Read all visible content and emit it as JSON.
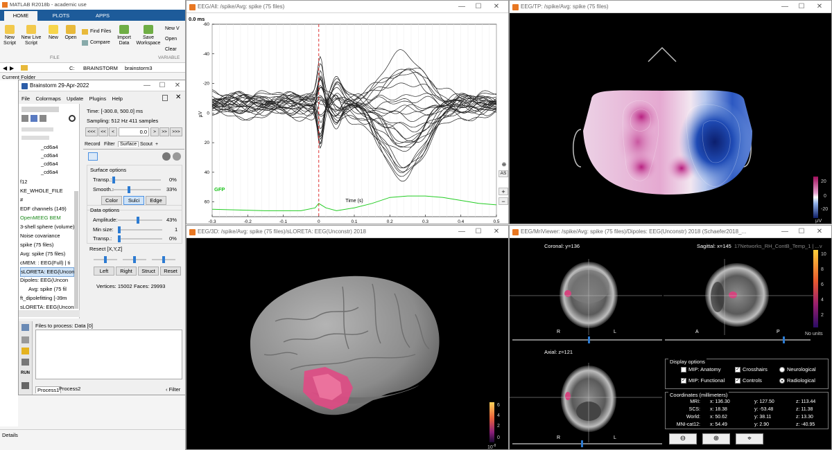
{
  "matlab": {
    "title": "MATLAB R2018b - academic use",
    "tabs": [
      "HOME",
      "PLOTS",
      "APPS"
    ],
    "ribbon": [
      {
        "label": "New Script",
        "icon": "new-script-icon"
      },
      {
        "label": "New Live Script",
        "icon": "new-live-script-icon"
      },
      {
        "label": "New",
        "icon": "new-icon"
      },
      {
        "label": "Open",
        "icon": "open-folder-icon"
      },
      {
        "label": "Find Files",
        "icon": "find-files-icon"
      },
      {
        "label": "Compare",
        "icon": "compare-icon"
      },
      {
        "label": "Import Data",
        "icon": "import-icon"
      },
      {
        "label": "Save Workspace",
        "icon": "save-icon"
      },
      {
        "label": "New V",
        "icon": "new-variable-icon"
      },
      {
        "label": "Open",
        "icon": "open-variable-icon"
      },
      {
        "label": "Clear",
        "icon": "clear-icon"
      }
    ],
    "section_file": "FILE",
    "section_variable": "VARIABLE",
    "path": [
      "C:",
      "BRAINSTORM",
      "brainstorm3"
    ],
    "current_folder": "Current Folder",
    "details": "Details"
  },
  "bst": {
    "title": "Brainstorm 29-Apr-2022",
    "menu": [
      "File",
      "Colormaps",
      "Update",
      "Plugins",
      "Help"
    ],
    "time": "Time:  [-300.8, 500.0] ms",
    "sampling": "Sampling: 512 Hz    411 samples",
    "nav_buttons": [
      "<<<",
      "<<",
      "<"
    ],
    "nav_buttons_right": [
      ">",
      ">>",
      ">>>"
    ],
    "time_value": "0.0",
    "tabs": [
      "Record",
      "Filter",
      "Surface",
      "Scout",
      "+"
    ],
    "surface_options": "Surface options",
    "transp_label": "Transp.:",
    "transp_value": "0%",
    "smooth_label": "Smooth.:",
    "smooth_value": "33%",
    "shading_buttons": [
      "Color",
      "Sulci",
      "Edge"
    ],
    "data_options": "Data options",
    "amplitude_label": "Amplitude:",
    "amplitude_value": "43%",
    "minsize_label": "Min size:",
    "minsize_value": "1",
    "transp2_label": "Transp.:",
    "transp2_value": "0%",
    "resect_label": "Resect [X,Y,Z]",
    "resect_buttons": [
      "Left",
      "Right",
      "Struct",
      "Reset"
    ],
    "vertices": "Vertices: 15002",
    "faces": "Faces: 29993",
    "tree": [
      "_cd6a4",
      "_cd6a4",
      "_cd6a4",
      "_cd6a4",
      "f12",
      "KE_WHOLE_FILE",
      "#",
      "EDF channels (149)",
      "OpenMEEG BEM",
      "3-shell sphere (volume)",
      "Noise covariance",
      "spike (75 files)",
      "Avg: spike (75 files)",
      "cMEM: : EEG(Full) | ti",
      "sLORETA: EEG(Uncon",
      "Dipoles: EEG(Uncon",
      "Avg: spike (75 fil",
      "ft_dipolefitting [-39m",
      "sLORETA: EEG(Unconst"
    ],
    "process_title": "Files to process: Data [0]",
    "process_tabs": [
      "Process1",
      "Process2"
    ],
    "filter": "Filter",
    "run": "RUN"
  },
  "eeg_all": {
    "title": "EEG/All:                     /spike/Avg: spike (75 files)",
    "time_readout": "0.0 ms",
    "gfp_label": "GFP",
    "side_buttons": [
      "AS",
      "+",
      "−"
    ]
  },
  "eeg_tp": {
    "title": "EEG/TP:                     /spike/Avg: spike (75 files)",
    "colorbar_ticks": [
      "20",
      "0",
      "-20"
    ],
    "unit": "µV"
  },
  "eeg_3d": {
    "title": "EEG/3D:                     /spike/Avg: spike (75 files)/sLORETA: EEG(Unconstr) 2018",
    "colorbar_ticks": [
      "6",
      "4",
      "2",
      "0"
    ],
    "exponent": "10",
    "exponent_power": "-8"
  },
  "mri": {
    "title": "EEG/MriViewer:                     /spike/Avg: spike (75 files)/Dipoles: EEG(Unconstr) 2018 (Schaefer2018_...",
    "coronal": "Coronal:  y=136",
    "sagittal": "Sagittal:  x=145",
    "sagittal_extra": "17Networks_RH_ContB_Temp_1 | ...v",
    "axial": "Axial:  z=121",
    "coronal_letters": [
      "R",
      "L"
    ],
    "sagittal_letters": [
      "A",
      "P"
    ],
    "axial_letters": [
      "R",
      "L"
    ],
    "colorbar_ticks": [
      "10",
      "8",
      "6",
      "4",
      "2"
    ],
    "no_units": "No units",
    "display_options": "Display options",
    "options": [
      {
        "label": "MIP: Anatomy",
        "kind": "check",
        "checked": false
      },
      {
        "label": "Crosshairs",
        "kind": "check",
        "checked": true
      },
      {
        "label": "Neurological",
        "kind": "radio",
        "checked": false
      },
      {
        "label": "MIP: Functional",
        "kind": "check",
        "checked": true
      },
      {
        "label": "Controls",
        "kind": "check",
        "checked": true
      },
      {
        "label": "Radiological",
        "kind": "radio",
        "checked": true
      }
    ],
    "coords_title": "Coordinates (millimeters)",
    "coords": [
      {
        "name": "MRI:",
        "x": "x: 136.30",
        "y": "y: 127.50",
        "z": "z: 113.44"
      },
      {
        "name": "SCS:",
        "x": "x: 18.38",
        "y": "y: -53.48",
        "z": "z: 11.38"
      },
      {
        "name": "World:",
        "x": "x: 50.62",
        "y": "y: 38.11",
        "z": "z: 13.30"
      },
      {
        "name": "MNI-cat12:",
        "x": "x: 54.49",
        "y": "y: 2.90",
        "z": "z: -40.95"
      }
    ]
  },
  "chart_data": {
    "type": "line",
    "title": "",
    "xlabel": "Time (s)",
    "ylabel": "µV",
    "xlim": [
      -0.3,
      0.5
    ],
    "ylim": [
      -60,
      70
    ],
    "y_reversed": true,
    "x_ticks": [
      "-0.3",
      "-0.2",
      "-0.1",
      "0",
      "0.1",
      "0.2",
      "0.3",
      "0.4",
      "0.5"
    ],
    "y_ticks": [
      "-60",
      "-40",
      "-20",
      "0",
      "20",
      "40",
      "60"
    ],
    "cursor_x": 0.0,
    "n_channels": 28,
    "series": [
      {
        "name": "GFP",
        "x": [
          -0.3,
          -0.15,
          -0.05,
          -0.01,
          0.0,
          0.02,
          0.05,
          0.1,
          0.15,
          0.2,
          0.25,
          0.3,
          0.35,
          0.4,
          0.45,
          0.5
        ],
        "values": [
          65,
          66,
          66,
          64,
          61,
          64,
          66,
          64,
          61,
          57,
          56,
          56,
          57,
          59,
          61,
          62
        ]
      }
    ]
  }
}
